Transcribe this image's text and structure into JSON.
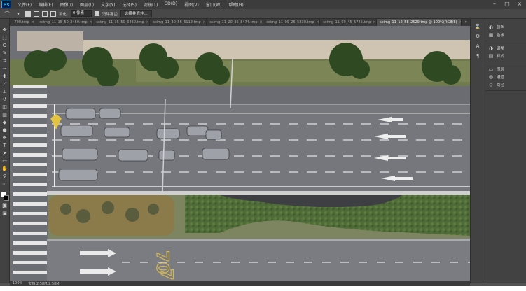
{
  "app": {
    "logo": "Ps"
  },
  "menu": [
    "文件(F)",
    "编辑(E)",
    "图像(I)",
    "图层(L)",
    "文字(Y)",
    "选择(S)",
    "滤镜(T)",
    "3D(D)",
    "视图(V)",
    "窗口(W)",
    "帮助(H)"
  ],
  "window_controls": [
    "–",
    "□",
    "×"
  ],
  "options": {
    "feather_label": "羽化:",
    "feather_value": "0 像素",
    "antialias_label": "消除锯齿",
    "select_mask_label": "选择并遮住..."
  },
  "tabs": [
    {
      "label": "_708.tmp"
    },
    {
      "label": "scimg_11_15_50_2459.tmp"
    },
    {
      "label": "scimg_11_35_50_6430.tmp"
    },
    {
      "label": "scimg_11_30_56_6118.tmp"
    },
    {
      "label": "scimg_11_20_36_8474.tmp"
    },
    {
      "label": "scimg_11_09_26_5830.tmp"
    },
    {
      "label": "scimg_11_09_45_5745.tmp"
    },
    {
      "label": "scimg_11_12_58_2529.tmp @ 100%(RGB/8)",
      "active": true
    }
  ],
  "tab_close": "×",
  "tab_more": "»",
  "panels": {
    "group1": [
      {
        "icon": "color-icon",
        "glyph": "◐",
        "label": "颜色"
      },
      {
        "icon": "swatches-icon",
        "glyph": "▦",
        "label": "色板"
      }
    ],
    "group2": [
      {
        "icon": "adjustments-icon",
        "glyph": "◑",
        "label": "调整"
      },
      {
        "icon": "styles-icon",
        "glyph": "▤",
        "label": "样式"
      }
    ],
    "group3": [
      {
        "icon": "layers-icon",
        "glyph": "▭",
        "label": "图层"
      },
      {
        "icon": "channels-icon",
        "glyph": "◎",
        "label": "通道"
      },
      {
        "icon": "paths-icon",
        "glyph": "◇",
        "label": "路径"
      }
    ]
  },
  "status": {
    "zoom": "100%",
    "doc": "文档:2.58M/2.58M"
  },
  "road_markings": {
    "left_number": "70",
    "right_number": "70"
  },
  "colors": {
    "foreground": "#ffffff",
    "background": "#000000",
    "ps_blue": "#31a8ff"
  }
}
